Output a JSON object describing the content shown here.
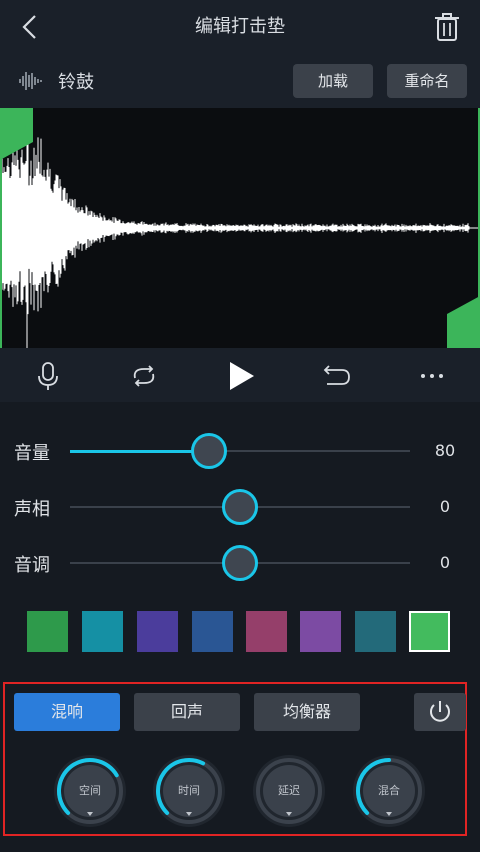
{
  "header": {
    "title": "编辑打击垫"
  },
  "sample": {
    "name": "铃鼓",
    "load_label": "加载",
    "rename_label": "重命名"
  },
  "sliders": [
    {
      "label": "音量",
      "value": "80",
      "fraction": 0.41
    },
    {
      "label": "声相",
      "value": "0",
      "fraction": 0.5
    },
    {
      "label": "音调",
      "value": "0",
      "fraction": 0.5
    }
  ],
  "swatches": [
    "#2e9a4b",
    "#1590a4",
    "#4b3d9c",
    "#2a5694",
    "#953f6a",
    "#7c4ba3",
    "#236a7a",
    "#43bb5e"
  ],
  "colors": {
    "accent": "#1ac6e8",
    "active_tab": "#2b7ddb",
    "marker": "#3cb55a",
    "highlight_border": "#e02424"
  },
  "fx": {
    "tabs": [
      {
        "label": "混响",
        "active": true
      },
      {
        "label": "回声",
        "active": false
      },
      {
        "label": "均衡器",
        "active": false
      }
    ],
    "knobs": [
      {
        "label": "空间",
        "level": 0.72
      },
      {
        "label": "时间",
        "level": 0.6
      },
      {
        "label": "延迟",
        "level": 0.0
      },
      {
        "label": "混合",
        "level": 0.5
      }
    ]
  },
  "icons": [
    "back-arrow-icon",
    "trash-icon",
    "waveform-icon",
    "microphone-icon",
    "loop-icon",
    "play-icon",
    "undo-icon",
    "more-icon",
    "power-icon"
  ]
}
